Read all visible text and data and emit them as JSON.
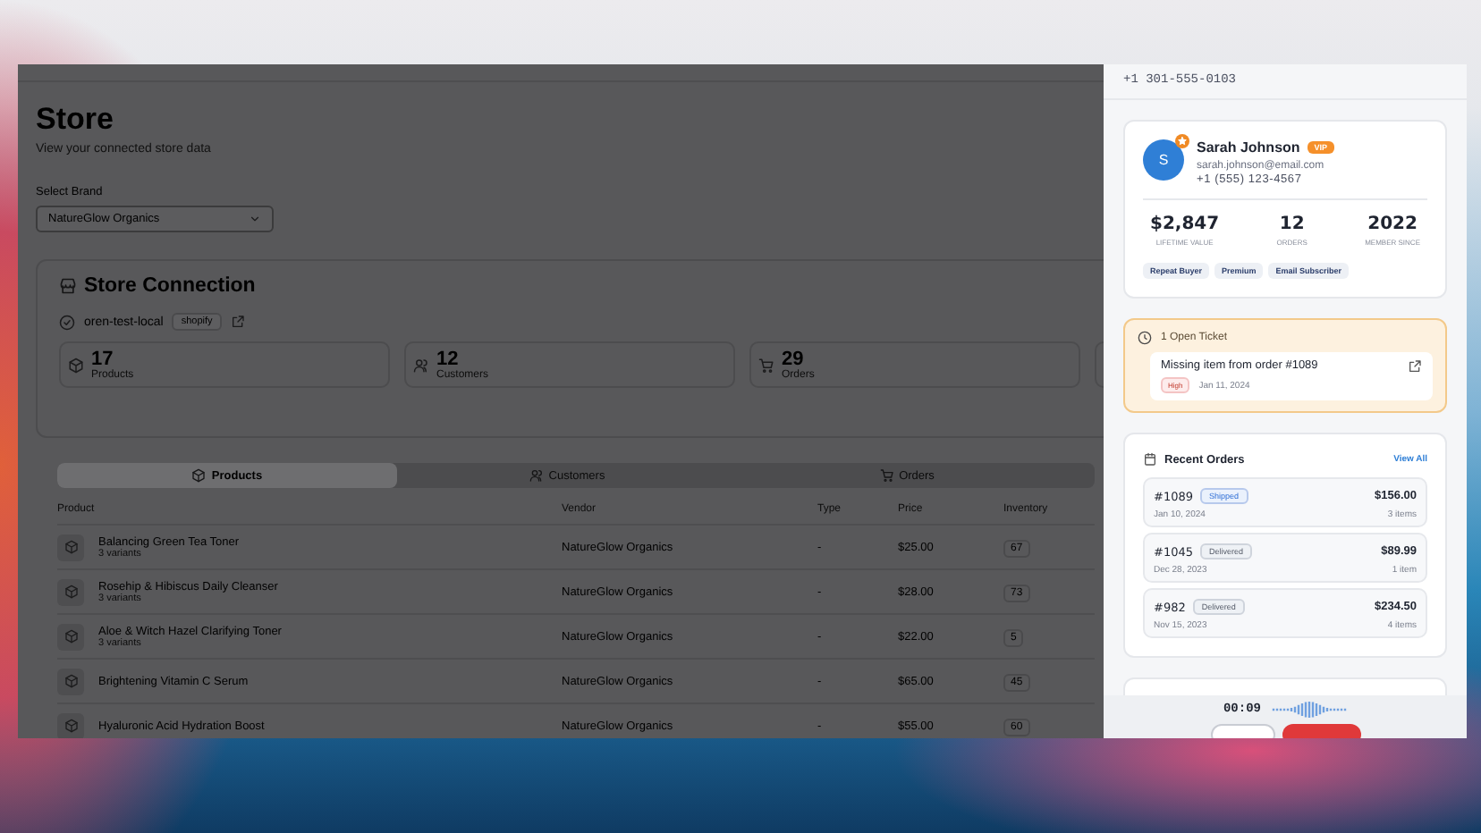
{
  "store_page": {
    "title": "Store",
    "subtitle": "View your connected store data",
    "brand_label": "Select Brand",
    "brand_select": {
      "value": "NatureGlow Organics"
    },
    "connection": {
      "title": "Store Connection",
      "store_name": "oren-test-local",
      "platform": "shopify",
      "stats": [
        {
          "kind": "products",
          "value": "17",
          "label": "Products"
        },
        {
          "kind": "customers",
          "value": "12",
          "label": "Customers"
        },
        {
          "kind": "orders",
          "value": "29",
          "label": "Orders"
        }
      ]
    },
    "tabs": [
      {
        "kind": "products",
        "label": "Products",
        "selected": true
      },
      {
        "kind": "customers",
        "label": "Customers",
        "selected": false
      },
      {
        "kind": "orders",
        "label": "Orders",
        "selected": false
      }
    ],
    "table": {
      "columns": [
        "Product",
        "Vendor",
        "Type",
        "Price",
        "Inventory"
      ],
      "rows": [
        {
          "product": "Balancing Green Tea Toner",
          "variants": "3 variants",
          "vendor": "NatureGlow Organics",
          "type": "-",
          "price": "$25.00",
          "inventory": "67"
        },
        {
          "product": "Rosehip & Hibiscus Daily Cleanser",
          "variants": "3 variants",
          "vendor": "NatureGlow Organics",
          "type": "-",
          "price": "$28.00",
          "inventory": "73"
        },
        {
          "product": "Aloe & Witch Hazel Clarifying Toner",
          "variants": "3 variants",
          "vendor": "NatureGlow Organics",
          "type": "-",
          "price": "$22.00",
          "inventory": "5"
        },
        {
          "product": "Brightening Vitamin C Serum",
          "vendor": "NatureGlow Organics",
          "type": "-",
          "price": "$65.00",
          "inventory": "45"
        },
        {
          "product": "Hyaluronic Acid Hydration Boost",
          "vendor": "NatureGlow Organics",
          "type": "-",
          "price": "$55.00",
          "inventory": "60"
        }
      ]
    }
  },
  "drawer": {
    "phone": "+1 301-555-0103",
    "customer": {
      "initial": "S",
      "name": "Sarah Johnson",
      "badge": "VIP",
      "email": "sarah.johnson@email.com",
      "phone": "+1 (555) 123-4567",
      "stats": [
        {
          "value": "$2,847",
          "label": "LIFETIME VALUE"
        },
        {
          "value": "12",
          "label": "ORDERS"
        },
        {
          "value": "2022",
          "label": "MEMBER SINCE"
        }
      ],
      "tags": [
        "Repeat Buyer",
        "Premium",
        "Email Subscriber"
      ]
    },
    "ticket": {
      "heading": "1 Open Ticket",
      "title": "Missing item from order #1089",
      "priority": "High",
      "date": "Jan 11, 2024"
    },
    "orders": {
      "title": "Recent Orders",
      "link": "View All",
      "items": [
        {
          "number": "#1089",
          "status": "Shipped",
          "kind": "shipped",
          "date": "Jan 10, 2024",
          "total": "$156.00",
          "count": "3 items"
        },
        {
          "number": "#1045",
          "status": "Delivered",
          "kind": "delivered",
          "date": "Dec 28, 2023",
          "total": "$89.99",
          "count": "1 item"
        },
        {
          "number": "#982",
          "status": "Delivered",
          "kind": "delivered",
          "date": "Nov 15, 2023",
          "total": "$234.50",
          "count": "4 items"
        }
      ]
    },
    "recording": {
      "time": "00:09"
    }
  }
}
